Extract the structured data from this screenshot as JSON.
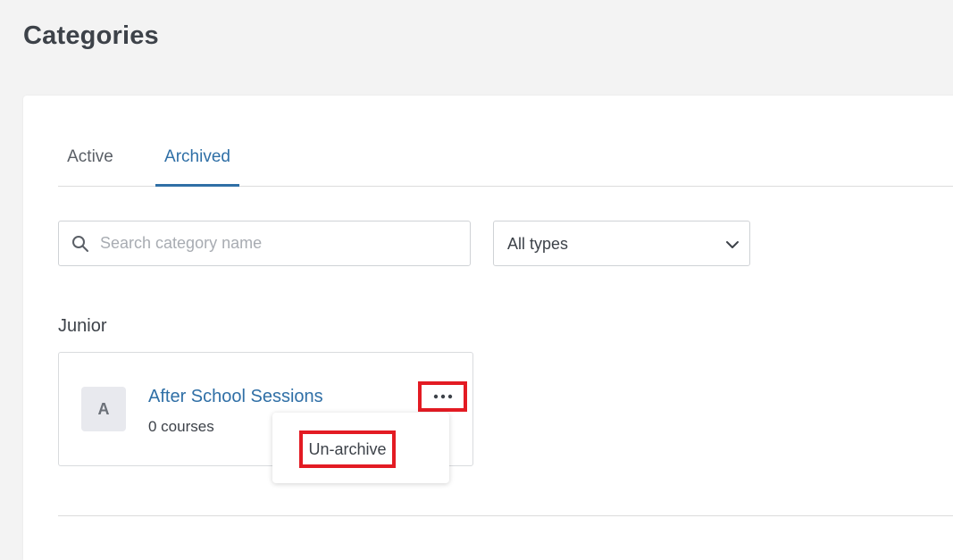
{
  "page": {
    "title": "Categories"
  },
  "tabs": [
    {
      "label": "Active"
    },
    {
      "label": "Archived"
    }
  ],
  "search": {
    "placeholder": "Search category name",
    "value": ""
  },
  "type_filter": {
    "selected": "All types"
  },
  "groups": [
    {
      "label": "Junior",
      "categories": [
        {
          "initial": "A",
          "name": "After School Sessions",
          "count": "0 courses"
        }
      ]
    }
  ],
  "menu": {
    "items": [
      {
        "label": "Un-archive"
      }
    ]
  },
  "colors": {
    "accent": "#2f6fa6",
    "highlight": "#e31b23",
    "background": "#f3f3f3"
  },
  "icons": {
    "search": "search-icon",
    "select": "chevron-down-icon",
    "more": "more-horizontal-icon"
  }
}
